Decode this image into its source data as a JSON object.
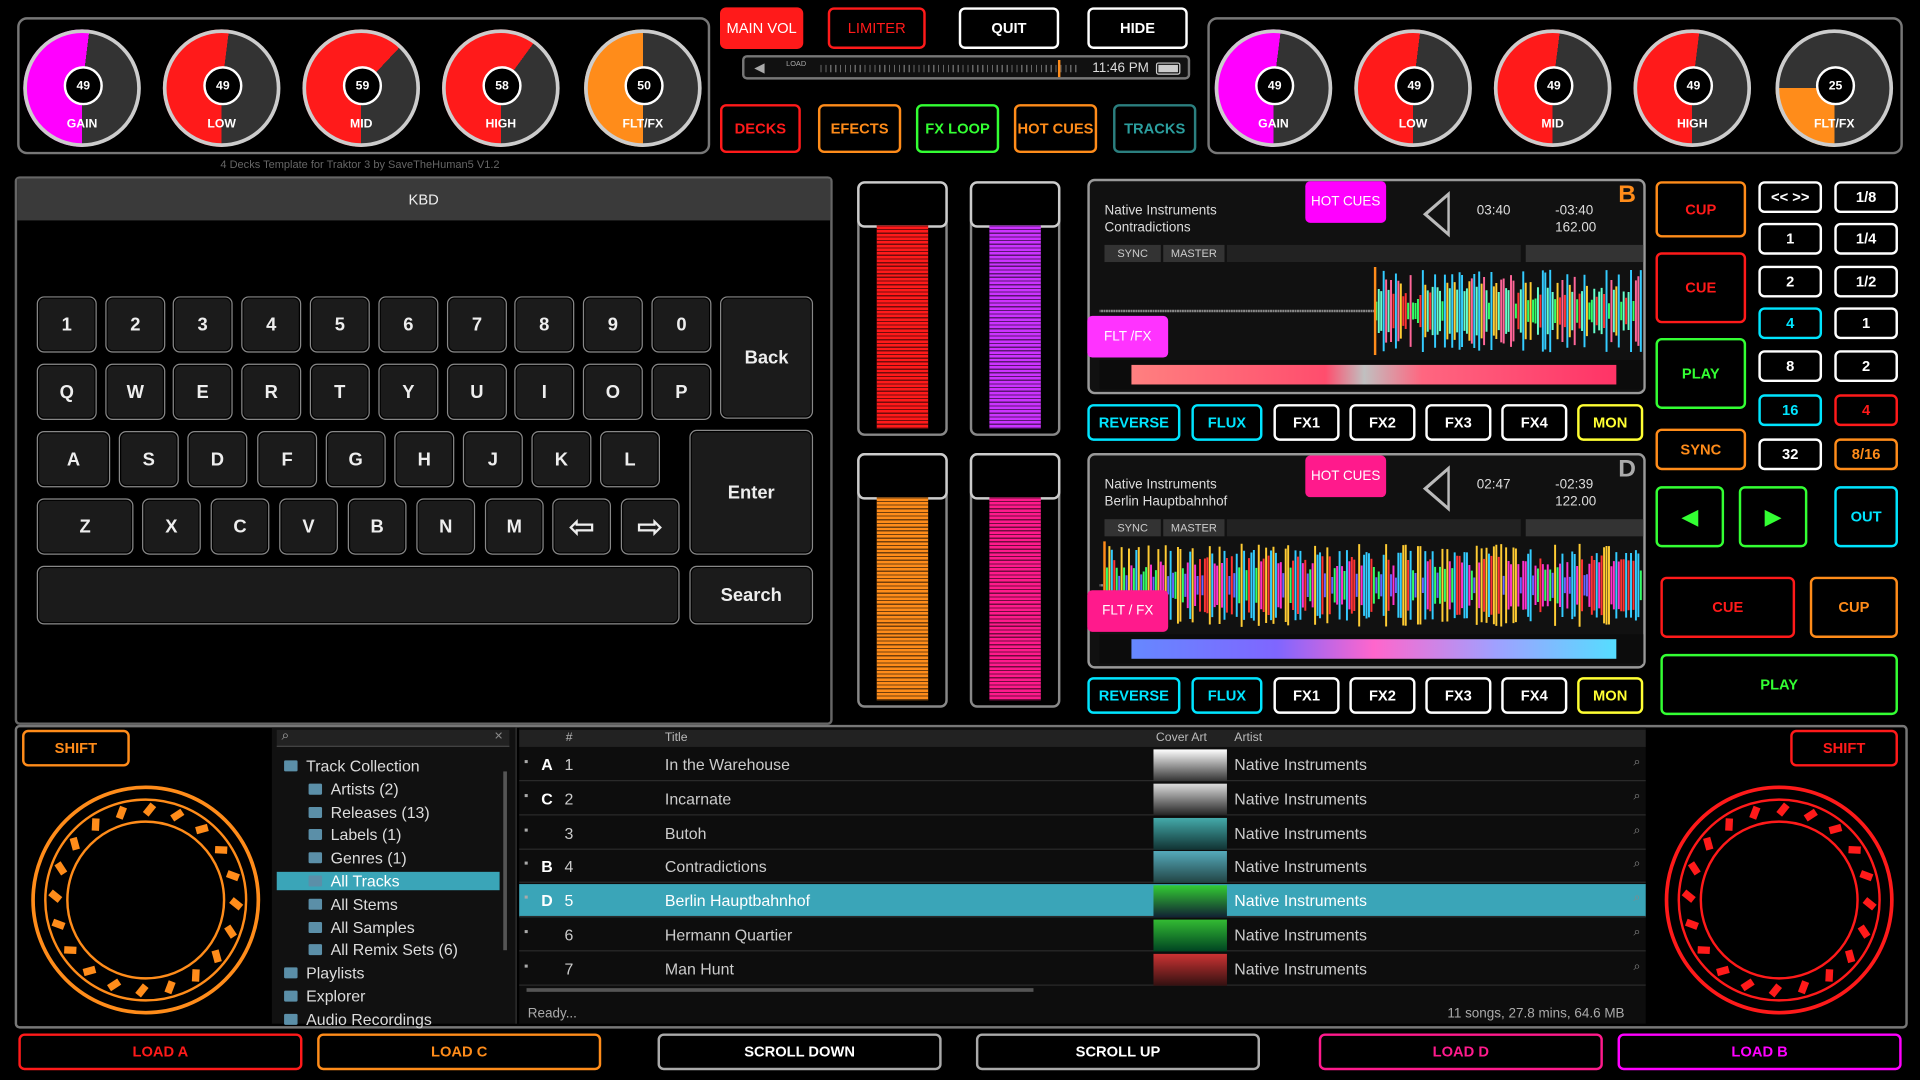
{
  "colors": {
    "magenta": "#ff00ff",
    "red": "#ff1a1a",
    "orange": "#ff8c1a",
    "green": "#33ff33",
    "cyan": "#00e5ff",
    "pink": "#ff1a8c",
    "teal": "#3aa5b8"
  },
  "left_knobs": [
    {
      "value": "49",
      "label": "GAIN",
      "color": "#ff00ff",
      "fill": 0.52
    },
    {
      "value": "49",
      "label": "LOW",
      "color": "#ff1a1a",
      "fill": 0.52
    },
    {
      "value": "59",
      "label": "MID",
      "color": "#ff1a1a",
      "fill": 0.62
    },
    {
      "value": "58",
      "label": "HIGH",
      "color": "#ff1a1a",
      "fill": 0.6
    },
    {
      "value": "50",
      "label": "FLT/FX",
      "color": "#ff8c1a",
      "fill": 0.5
    }
  ],
  "right_knobs": [
    {
      "value": "49",
      "label": "GAIN",
      "color": "#ff00ff",
      "fill": 0.52
    },
    {
      "value": "49",
      "label": "LOW",
      "color": "#ff1a1a",
      "fill": 0.52
    },
    {
      "value": "49",
      "label": "MID",
      "color": "#ff1a1a",
      "fill": 0.52
    },
    {
      "value": "49",
      "label": "HIGH",
      "color": "#ff1a1a",
      "fill": 0.52
    },
    {
      "value": "25",
      "label": "FLT/FX",
      "color": "#ff8c1a",
      "fill": 0.25
    }
  ],
  "top": {
    "main_vol": "MAIN VOL",
    "limiter": "LIMITER",
    "quit": "QUIT",
    "hide": "HIDE",
    "clock": "11:46 PM",
    "load": "LOAD",
    "decks": "DECKS",
    "efects": "EFECTS",
    "fx_loop": "FX LOOP",
    "hot_cues": "HOT CUES",
    "tracks": "TRACKS",
    "credit": "4 Decks Template for Traktor 3 by SaveTheHuman5 V1.2"
  },
  "keyboard": {
    "title": "KBD",
    "row1": [
      "1",
      "2",
      "3",
      "4",
      "5",
      "6",
      "7",
      "8",
      "9",
      "0"
    ],
    "row2": [
      "Q",
      "W",
      "E",
      "R",
      "T",
      "Y",
      "U",
      "I",
      "O",
      "P"
    ],
    "row3": [
      "A",
      "S",
      "D",
      "F",
      "G",
      "H",
      "J",
      "K",
      "L"
    ],
    "row4": [
      "Z",
      "X",
      "C",
      "V",
      "B",
      "N",
      "M"
    ],
    "back": "Back",
    "enter": "Enter",
    "search": "Search",
    "left_arrow": "⇦",
    "right_arrow": "⇨"
  },
  "deck_b": {
    "artist": "Native Instruments",
    "title": "Contradictions",
    "hot_cues": "HOT CUES",
    "elapsed": "03:40",
    "remaining": "-03:40",
    "bpm": "162.00",
    "letter": "B",
    "sync": "SYNC",
    "master": "MASTER",
    "flt": "FLT /FX"
  },
  "deck_d": {
    "artist": "Native Instruments",
    "title": "Berlin Hauptbahnhof",
    "hot_cues": "HOT CUES",
    "elapsed": "02:47",
    "remaining": "-02:39",
    "bpm": "122.00",
    "letter": "D",
    "sync": "SYNC",
    "master": "MASTER",
    "flt": "FLT / FX"
  },
  "fx_row": {
    "reverse": "REVERSE",
    "flux": "FLUX",
    "fx1": "FX1",
    "fx2": "FX2",
    "fx3": "FX3",
    "fx4": "FX4",
    "mon": "MON"
  },
  "transport": {
    "cup": "CUP",
    "cue": "CUE",
    "play": "PLAY",
    "sync": "SYNC",
    "out": "OUT",
    "left": "◀",
    "right": "▶"
  },
  "loops": {
    "nav": "<< >>",
    "col1": [
      "1",
      "2",
      "4",
      "8",
      "16",
      "32"
    ],
    "col2": [
      "1/8",
      "1/4",
      "1/2",
      "1",
      "2",
      "4",
      "8/16"
    ]
  },
  "browser": {
    "search_icon": "⌕",
    "tree": [
      "Track Collection",
      "Artists (2)",
      "Releases (13)",
      "Labels (1)",
      "Genres (1)",
      "All Tracks",
      "All Stems",
      "All Samples",
      "All Remix Sets (6)",
      "Playlists",
      "Explorer",
      "Audio Recordings"
    ],
    "headers": {
      "num": "#",
      "title": "Title",
      "cover": "Cover Art",
      "artist": "Artist"
    },
    "rows": [
      {
        "deck": "A",
        "num": "1",
        "title": "In  the Warehouse",
        "artist": "Native Instruments"
      },
      {
        "deck": "C",
        "num": "2",
        "title": "Incarnate",
        "artist": "Native Instruments"
      },
      {
        "deck": "",
        "num": "3",
        "title": "Butoh",
        "artist": "Native Instruments"
      },
      {
        "deck": "B",
        "num": "4",
        "title": "Contradictions",
        "artist": "Native Instruments"
      },
      {
        "deck": "D",
        "num": "5",
        "title": "Berlin Hauptbahnhof",
        "artist": "Native Instruments"
      },
      {
        "deck": "",
        "num": "6",
        "title": "Hermann Quartier",
        "artist": "Native Instruments"
      },
      {
        "deck": "",
        "num": "7",
        "title": "Man Hunt",
        "artist": "Native Instruments"
      }
    ],
    "status": "Ready...",
    "summary": "11 songs, 27.8 mins, 64.6 MB"
  },
  "shift": "SHIFT",
  "bottom": {
    "load_a": "LOAD A",
    "load_c": "LOAD C",
    "scroll_down": "SCROLL DOWN",
    "scroll_up": "SCROLL UP",
    "load_d": "LOAD D",
    "load_b": "LOAD B"
  }
}
